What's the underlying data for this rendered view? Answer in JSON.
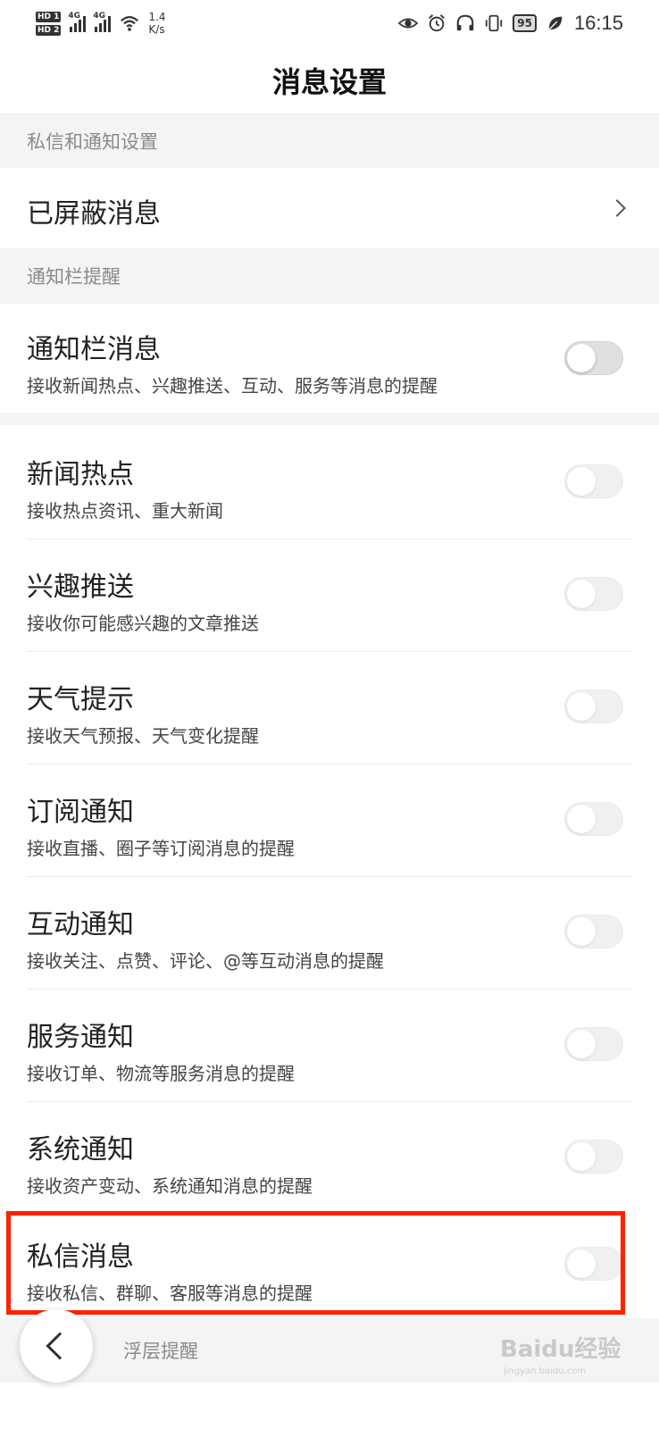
{
  "status_bar": {
    "hd1": "HD 1",
    "hd2": "HD 2",
    "net1": "4G",
    "net2": "4G",
    "speed_value": "1.4",
    "speed_unit": "K/s",
    "battery": "95",
    "time": "16:15",
    "icons": [
      "eye-icon",
      "alarm-icon",
      "headphones-icon",
      "vibrate-icon",
      "leaf-icon",
      "wifi-icon"
    ]
  },
  "header": {
    "title": "消息设置"
  },
  "sections": {
    "privacy": {
      "label": "私信和通知设置"
    },
    "notification_bar": {
      "label": "通知栏提醒"
    },
    "floating": {
      "label": "浮层提醒"
    }
  },
  "blocked": {
    "title": "已屏蔽消息"
  },
  "notif_bar_msg": {
    "title": "通知栏消息",
    "desc": "接收新闻热点、兴趣推送、互动、服务等消息的提醒",
    "enabled": false
  },
  "items": [
    {
      "title": "新闻热点",
      "desc": "接收热点资讯、重大新闻",
      "enabled": false
    },
    {
      "title": "兴趣推送",
      "desc": "接收你可能感兴趣的文章推送",
      "enabled": false
    },
    {
      "title": "天气提示",
      "desc": "接收天气预报、天气变化提醒",
      "enabled": false
    },
    {
      "title": "订阅通知",
      "desc": "接收直播、圈子等订阅消息的提醒",
      "enabled": false
    },
    {
      "title": "互动通知",
      "desc": "接收关注、点赞、评论、@等互动消息的提醒",
      "enabled": false
    },
    {
      "title": "服务通知",
      "desc": "接收订单、物流等服务消息的提醒",
      "enabled": false
    },
    {
      "title": "系统通知",
      "desc": "接收资产变动、系统通知消息的提醒",
      "enabled": false
    },
    {
      "title": "私信消息",
      "desc": "接收私信、群聊、客服等消息的提醒",
      "enabled": false
    }
  ],
  "watermark": {
    "brand": "Bai",
    "brand2": "du",
    "cn": "经验",
    "url": "jingyan.baidu.com"
  },
  "colors": {
    "highlight": "#ff2200",
    "section_bg": "#f4f4f4"
  }
}
